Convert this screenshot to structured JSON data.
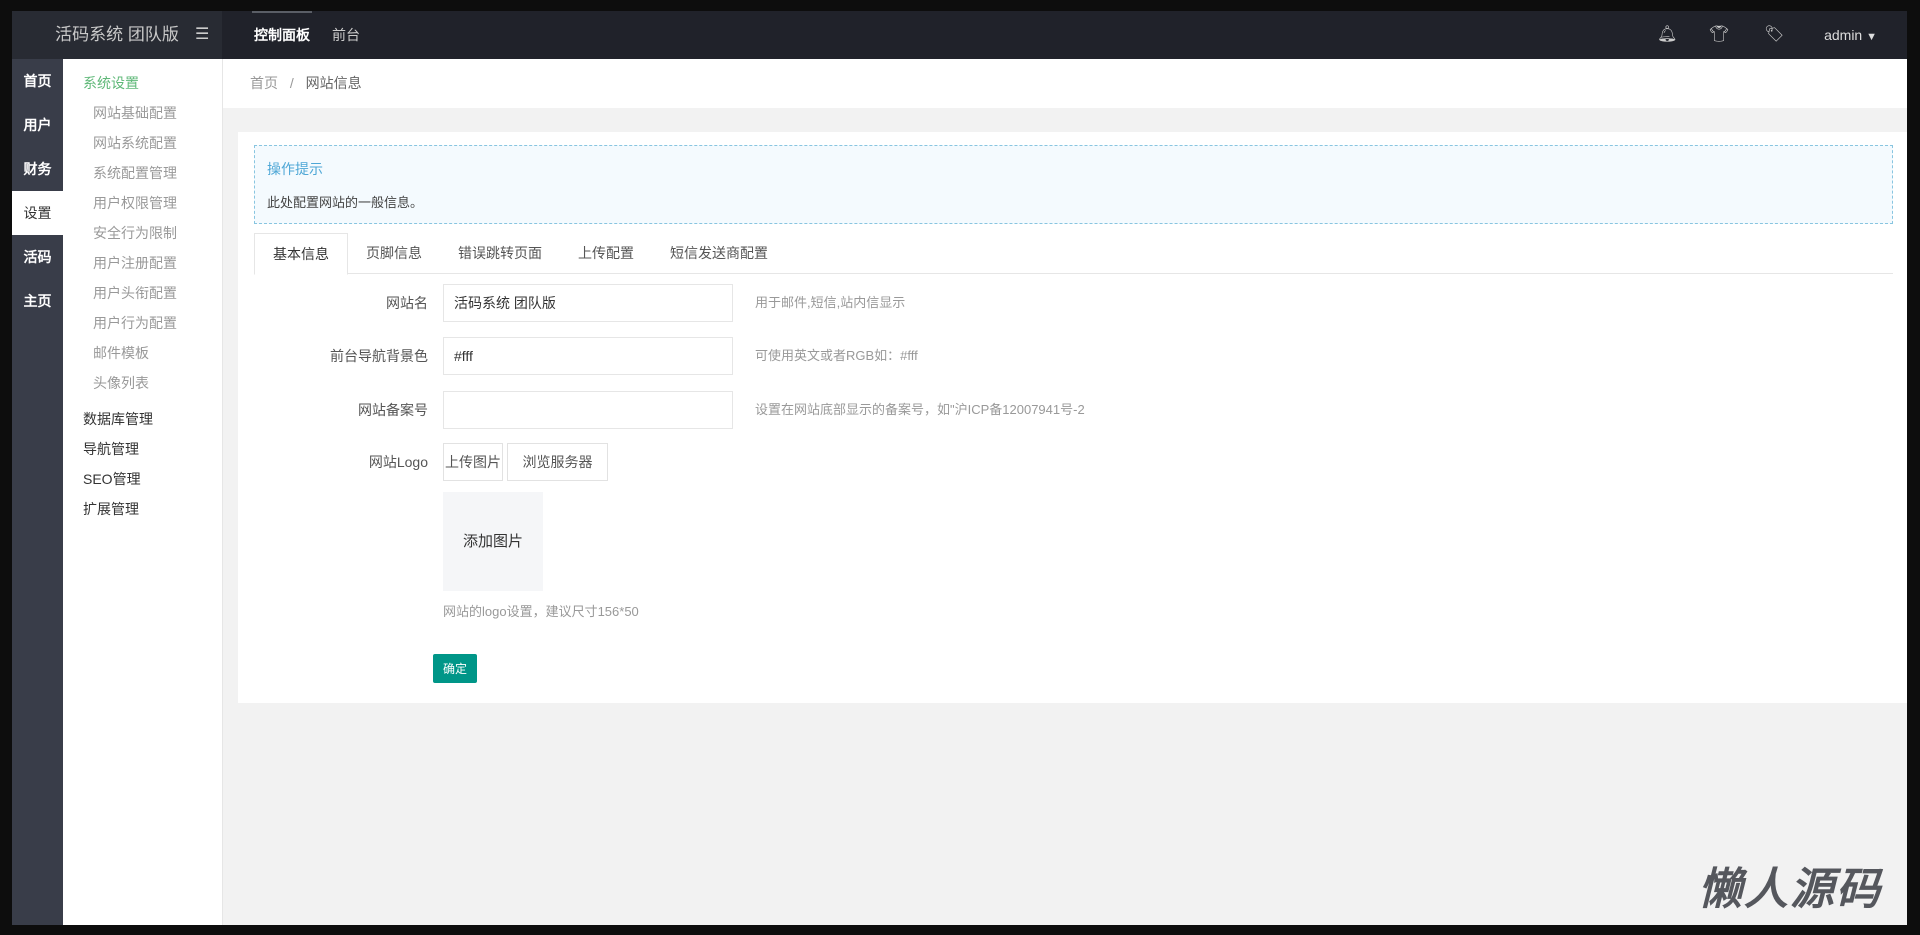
{
  "header": {
    "logo": "活码系统 团队版",
    "nav": [
      "控制面板",
      "前台"
    ],
    "user": "admin"
  },
  "icon_menu": [
    "首页",
    "用户",
    "财务",
    "设置",
    "活码",
    "主页"
  ],
  "submenu": {
    "active_group": "系统设置",
    "items": [
      "网站基础配置",
      "网站系统配置",
      "系统配置管理",
      "用户权限管理",
      "安全行为限制",
      "用户注册配置",
      "用户头衔配置",
      "用户行为配置",
      "邮件模板",
      "头像列表"
    ],
    "groups": [
      "数据库管理",
      "导航管理",
      "SEO管理",
      "扩展管理"
    ]
  },
  "breadcrumb": {
    "home": "首页",
    "sep": "/",
    "current": "网站信息"
  },
  "tip": {
    "title": "操作提示",
    "desc": "此处配置网站的一般信息。"
  },
  "tabs": [
    "基本信息",
    "页脚信息",
    "错误跳转页面",
    "上传配置",
    "短信发送商配置"
  ],
  "form": {
    "site_name": {
      "label": "网站名",
      "value": "活码系统 团队版",
      "hint": "用于邮件,短信,站内信显示"
    },
    "nav_bg": {
      "label": "前台导航背景色",
      "value": "#fff",
      "hint": "可使用英文或者RGB如：#fff"
    },
    "icp": {
      "label": "网站备案号",
      "value": "",
      "hint": "设置在网站底部显示的备案号，如\"沪ICP备12007941号-2"
    },
    "logo": {
      "label": "网站Logo",
      "upload": "上传图片",
      "browse": "浏览服务器",
      "placeholder": "添加图片",
      "hint": "网站的logo设置，建议尺寸156*50"
    },
    "submit": "确定"
  },
  "watermark": "懒人源码",
  "colors": {
    "accent": "#009688",
    "active_group": "#5fb878",
    "header": "#20222a",
    "sidebar": "#393d49"
  }
}
